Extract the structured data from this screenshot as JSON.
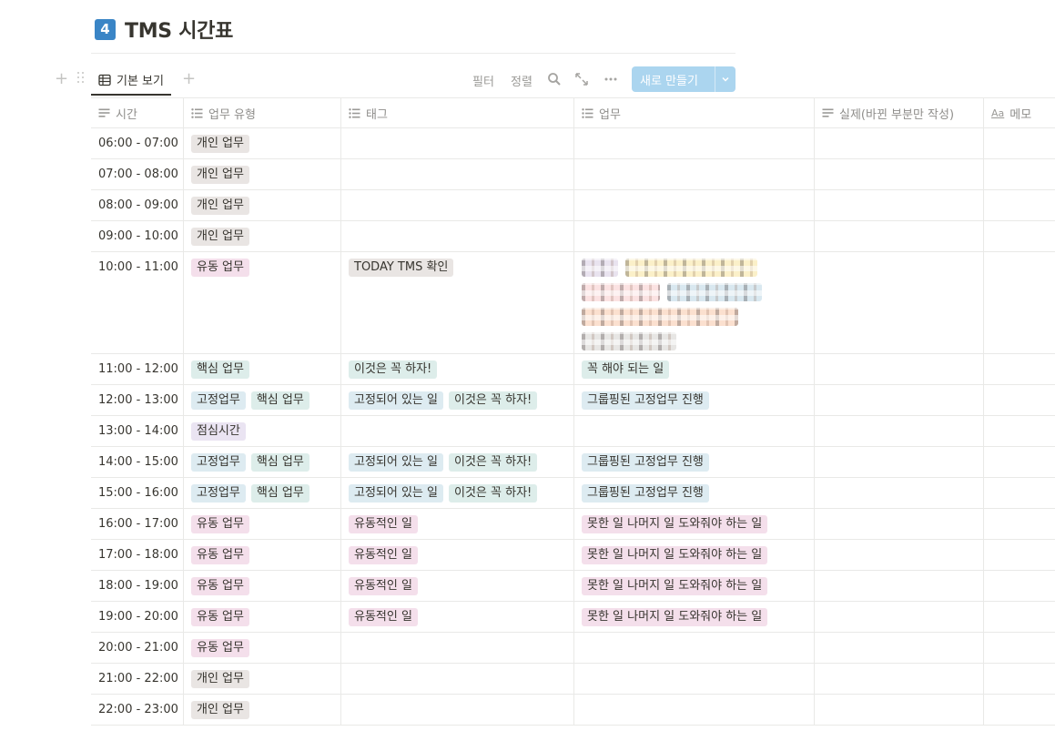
{
  "page": {
    "badge": "4",
    "title": "TMS 시간표"
  },
  "toolbar": {
    "view_tab_label": "기본 보기",
    "filter_label": "필터",
    "sort_label": "정렬",
    "new_button_label": "새로 만들기"
  },
  "columns": [
    {
      "label": "시간",
      "icon": "text-lines-icon"
    },
    {
      "label": "업무 유형",
      "icon": "list-icon"
    },
    {
      "label": "태그",
      "icon": "list-icon"
    },
    {
      "label": "업무",
      "icon": "list-icon"
    },
    {
      "label": "실제(바뀐 부분만 작성)",
      "icon": "text-lines-icon"
    },
    {
      "label": "메모",
      "icon": "aa-title-icon"
    }
  ],
  "colors": {
    "badge": "#3a85c6",
    "new_button": "#abd5ef",
    "tag_brown": "#e9e5e3",
    "tag_pink": "#f4dfeb",
    "tag_green": "#ddedea",
    "tag_blue": "#ddebf1",
    "tag_purple": "#eae4f2"
  },
  "rows": [
    {
      "time": "06:00 - 07:00",
      "types": [
        {
          "label": "개인 업무",
          "color": "brown"
        }
      ],
      "tags": [],
      "tasks": []
    },
    {
      "time": "07:00 - 08:00",
      "types": [
        {
          "label": "개인 업무",
          "color": "brown"
        }
      ],
      "tags": [],
      "tasks": []
    },
    {
      "time": "08:00 - 09:00",
      "types": [
        {
          "label": "개인 업무",
          "color": "brown"
        }
      ],
      "tags": [],
      "tasks": []
    },
    {
      "time": "09:00 - 10:00",
      "types": [
        {
          "label": "개인 업무",
          "color": "brown"
        }
      ],
      "tags": [],
      "tasks": []
    },
    {
      "time": "10:00 - 11:00",
      "types": [
        {
          "label": "유동 업무",
          "color": "pink"
        }
      ],
      "tags": [
        {
          "label": "TODAY TMS 확인",
          "color": "brown"
        }
      ],
      "tasks": [],
      "redacted": true
    },
    {
      "time": "11:00 - 12:00",
      "types": [
        {
          "label": "핵심 업무",
          "color": "green"
        }
      ],
      "tags": [
        {
          "label": "이것은 꼭 하자!",
          "color": "green"
        }
      ],
      "tasks": [
        {
          "label": "꼭 해야 되는 일",
          "color": "green"
        }
      ]
    },
    {
      "time": "12:00 - 13:00",
      "types": [
        {
          "label": "고정업무",
          "color": "blue"
        },
        {
          "label": "핵심 업무",
          "color": "green"
        }
      ],
      "tags": [
        {
          "label": "고정되어 있는 일",
          "color": "blue"
        },
        {
          "label": "이것은 꼭 하자!",
          "color": "green"
        }
      ],
      "tasks": [
        {
          "label": "그룹핑된 고정업무 진행",
          "color": "blue"
        }
      ]
    },
    {
      "time": "13:00 - 14:00",
      "types": [
        {
          "label": "점심시간",
          "color": "purple"
        }
      ],
      "tags": [],
      "tasks": []
    },
    {
      "time": "14:00 - 15:00",
      "types": [
        {
          "label": "고정업무",
          "color": "blue"
        },
        {
          "label": "핵심 업무",
          "color": "green"
        }
      ],
      "tags": [
        {
          "label": "고정되어 있는 일",
          "color": "blue"
        },
        {
          "label": "이것은 꼭 하자!",
          "color": "green"
        }
      ],
      "tasks": [
        {
          "label": "그룹핑된 고정업무 진행",
          "color": "blue"
        }
      ]
    },
    {
      "time": "15:00 - 16:00",
      "types": [
        {
          "label": "고정업무",
          "color": "blue"
        },
        {
          "label": "핵심 업무",
          "color": "green"
        }
      ],
      "tags": [
        {
          "label": "고정되어 있는 일",
          "color": "blue"
        },
        {
          "label": "이것은 꼭 하자!",
          "color": "green"
        }
      ],
      "tasks": [
        {
          "label": "그룹핑된 고정업무 진행",
          "color": "blue"
        }
      ]
    },
    {
      "time": "16:00 - 17:00",
      "types": [
        {
          "label": "유동 업무",
          "color": "pink"
        }
      ],
      "tags": [
        {
          "label": "유동적인 일",
          "color": "pink"
        }
      ],
      "tasks": [
        {
          "label": "못한 일 나머지 일 도와줘야 하는 일",
          "color": "pink"
        }
      ]
    },
    {
      "time": "17:00 - 18:00",
      "types": [
        {
          "label": "유동 업무",
          "color": "pink"
        }
      ],
      "tags": [
        {
          "label": "유동적인 일",
          "color": "pink"
        }
      ],
      "tasks": [
        {
          "label": "못한 일 나머지 일 도와줘야 하는 일",
          "color": "pink"
        }
      ]
    },
    {
      "time": "18:00 - 19:00",
      "types": [
        {
          "label": "유동 업무",
          "color": "pink"
        }
      ],
      "tags": [
        {
          "label": "유동적인 일",
          "color": "pink"
        }
      ],
      "tasks": [
        {
          "label": "못한 일 나머지 일 도와줘야 하는 일",
          "color": "pink"
        }
      ]
    },
    {
      "time": "19:00 - 20:00",
      "types": [
        {
          "label": "유동 업무",
          "color": "pink"
        }
      ],
      "tags": [
        {
          "label": "유동적인 일",
          "color": "pink"
        }
      ],
      "tasks": [
        {
          "label": "못한 일 나머지 일 도와줘야 하는 일",
          "color": "pink"
        }
      ]
    },
    {
      "time": "20:00 - 21:00",
      "types": [
        {
          "label": "유동 업무",
          "color": "pink"
        }
      ],
      "tags": [],
      "tasks": []
    },
    {
      "time": "21:00 - 22:00",
      "types": [
        {
          "label": "개인 업무",
          "color": "brown"
        }
      ],
      "tags": [],
      "tasks": []
    },
    {
      "time": "22:00 - 23:00",
      "types": [
        {
          "label": "개인 업무",
          "color": "brown"
        }
      ],
      "tags": [],
      "tasks": []
    }
  ]
}
